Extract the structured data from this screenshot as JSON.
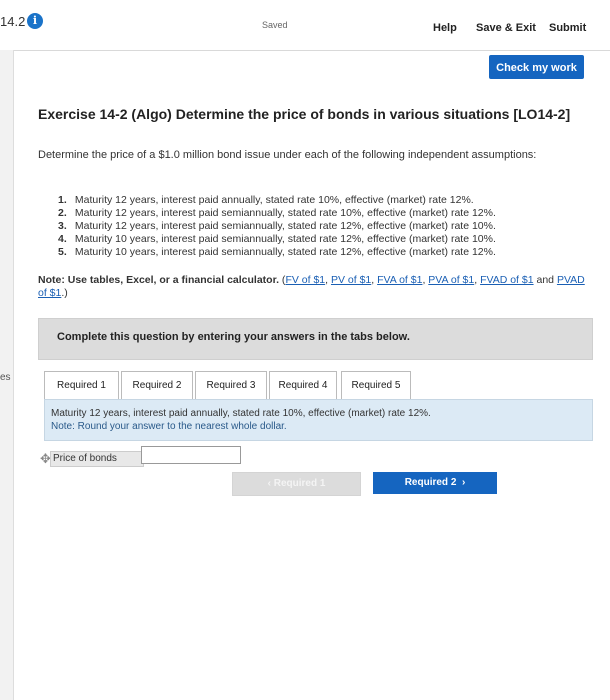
{
  "header": {
    "question_number": "14.2",
    "saved_label": "Saved",
    "help_label": "Help",
    "save_exit_label": "Save & Exit",
    "submit_label": "Submit",
    "check_label": "Check my work",
    "left_strip_label": "es"
  },
  "exercise": {
    "title": "Exercise 14-2 (Algo) Determine the price of bonds in various situations [LO14-2]",
    "intro": "Determine the price of a $1.0 million bond issue under each of the following independent assumptions:",
    "assumptions": [
      {
        "num": "1.",
        "text": "Maturity 12 years, interest paid annually, stated rate 10%, effective (market) rate 12%."
      },
      {
        "num": "2.",
        "text": "Maturity 12 years, interest paid semiannually, stated rate 10%, effective (market) rate 12%."
      },
      {
        "num": "3.",
        "text": "Maturity 12 years, interest paid semiannually, stated rate 12%, effective (market) rate 10%."
      },
      {
        "num": "4.",
        "text": "Maturity 10 years, interest paid semiannually, stated rate 12%, effective (market) rate 10%."
      },
      {
        "num": "5.",
        "text": "Maturity 10 years, interest paid semiannually, stated rate 12%, effective (market) rate 12%."
      }
    ],
    "note_bold": "Note: Use tables, Excel, or a financial calculator.",
    "note_open": " (",
    "links": [
      "FV of $1",
      "PV of $1",
      "FVA of $1",
      "PVA of $1",
      "FVAD of $1",
      "PVAD of $1"
    ],
    "link_sep": ", ",
    "and_word": " and ",
    "note_close": ".)"
  },
  "instructions": {
    "complete_label": "Complete this question by entering your answers in the tabs below."
  },
  "tabs": [
    "Required 1",
    "Required 2",
    "Required 3",
    "Required 4",
    "Required 5"
  ],
  "answer": {
    "line1": "Maturity 12 years, interest paid annually, stated rate 10%, effective (market) rate 12%.",
    "line2": "Note: Round your answer to the nearest whole dollar.",
    "price_label": "Price of bonds",
    "price_value": ""
  },
  "nav": {
    "prev_label": "Required 1",
    "next_label": "Required 2"
  },
  "colors": {
    "accent": "#1565c0",
    "answer_panel": "#dceaf5",
    "link": "#1a5fb4"
  }
}
